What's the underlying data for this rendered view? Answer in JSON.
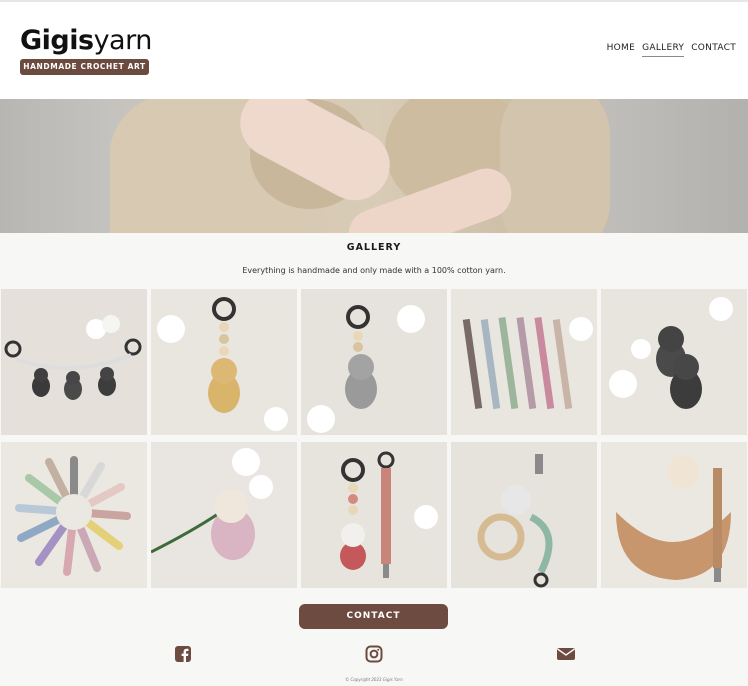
{
  "brand": {
    "name_bold": "Gigis",
    "name_light": "yarn",
    "tagline": "HANDMADE CROCHET ART"
  },
  "nav": {
    "items": [
      {
        "label": "HOME",
        "active": false
      },
      {
        "label": "GALLERY",
        "active": true
      },
      {
        "label": "CONTACT",
        "active": false
      }
    ]
  },
  "gallery": {
    "title": "GALLERY",
    "subtitle": "Everything is handmade and only made with a 100% cotton yarn."
  },
  "contact_button": "CONTACT",
  "social": {
    "icons": [
      "facebook-icon",
      "instagram-icon",
      "envelope-icon"
    ]
  },
  "footer": {
    "copyright": "© Copyright 2023 Gigis Yarn"
  },
  "colors": {
    "accent": "#6e4b40",
    "background": "#f7f7f5"
  }
}
